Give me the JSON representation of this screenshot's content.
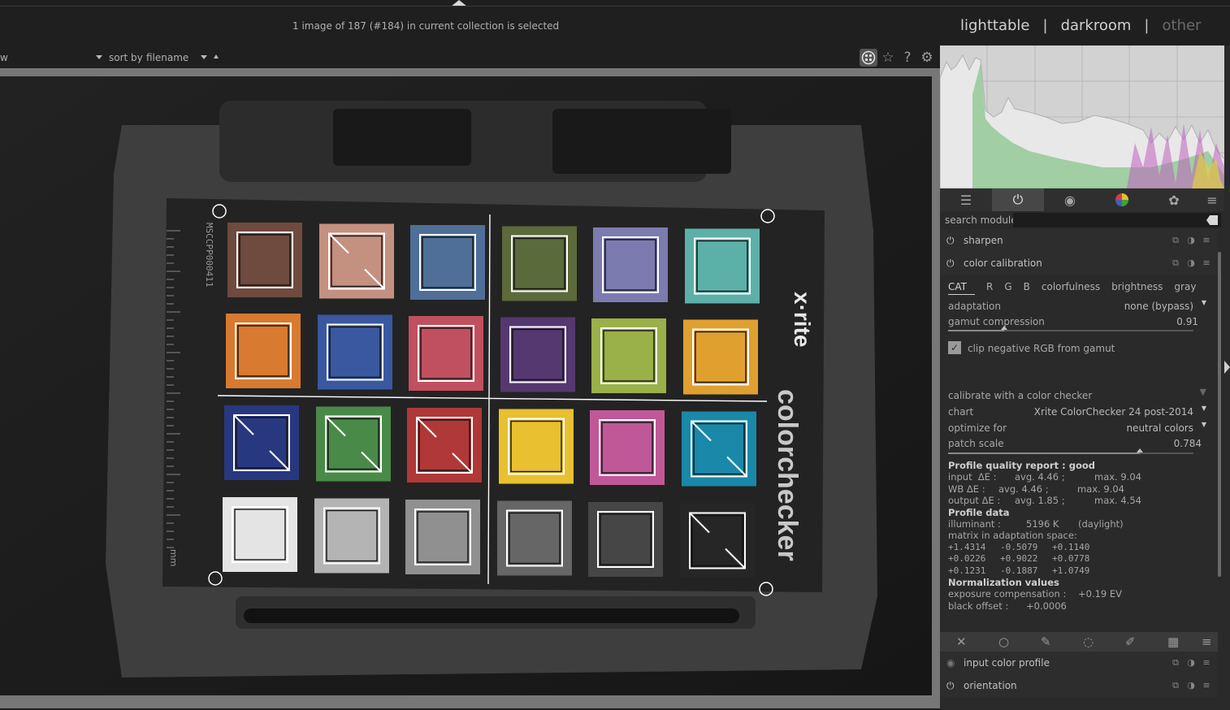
{
  "header": {
    "status_text": "1 image of 187 (#184) in current collection is selected",
    "views": [
      "lighttable",
      "darkroom",
      "other"
    ],
    "separator": "|"
  },
  "filterbar": {
    "left_fragment": "w",
    "sort_label": "sort by",
    "sort_value": "filename"
  },
  "right_panel": {
    "search_label": "search module",
    "search_placeholder": "",
    "modules": {
      "sharpen": "sharpen",
      "color_calibration": "color calibration",
      "input_color_profile": "input color profile",
      "orientation": "orientation"
    },
    "cc": {
      "tabs": [
        "CAT",
        "R",
        "G",
        "B",
        "colorfulness",
        "brightness",
        "gray"
      ],
      "adaptation_label": "adaptation",
      "adaptation_value": "none (bypass)",
      "gamut_label": "gamut compression",
      "gamut_value": "0.91",
      "gamut_fraction": 0.23,
      "clip_label": "clip negative RGB from gamut",
      "clip_checked": true,
      "checker_section": "calibrate with a color checker",
      "chart_label": "chart",
      "chart_value": "Xrite ColorChecker 24 post-2014",
      "optimize_label": "optimize for",
      "optimize_value": "neutral colors",
      "patch_label": "patch scale",
      "patch_value": "0.784",
      "patch_fraction": 0.78
    },
    "report": {
      "title": "Profile quality report : good",
      "input_label": "input  ΔE :",
      "input_avg": "avg. 4.46 ;",
      "input_max": "max. 9.04",
      "wb_label": "WB ΔE :",
      "wb_avg": "avg. 4.46 ;",
      "wb_max": "max. 9.04",
      "output_label": "output ΔE :",
      "output_avg": "avg. 1.85 ;",
      "output_max": "max. 4.54",
      "profile_title": "Profile data",
      "illuminant_label": "illuminant :",
      "illuminant_value": "5196 K",
      "illuminant_note": "(daylight)",
      "matrix_label": "matrix in adaptation space:",
      "matrix": [
        [
          "+1.4314",
          "-0.5079",
          "+0.1140"
        ],
        [
          "+0.0226",
          "+0.9022",
          "+0.0778"
        ],
        [
          "+0.1231",
          "-0.1887",
          "+1.0749"
        ]
      ],
      "norm_title": "Normalization values",
      "exposure_label": "exposure compensation :",
      "exposure_value": "+0.19 EV",
      "black_label": "black offset :",
      "black_value": "+0.0006"
    }
  },
  "checker": {
    "brand": "x·rite",
    "product": "colorchecker",
    "serial": "MSCCPP000411",
    "unit": "mm",
    "patches": [
      "#6f4a3e",
      "#c49080",
      "#4f6f98",
      "#5a6a3a",
      "#7b7bb0",
      "#5cb0a8",
      "#d87a30",
      "#3a58a0",
      "#c05060",
      "#553870",
      "#9ab048",
      "#e0a030",
      "#283880",
      "#4a8a48",
      "#b03838",
      "#e8c030",
      "#c05898",
      "#1a88a8",
      "#e4e4e4",
      "#b4b4b4",
      "#909090",
      "#666666",
      "#464646",
      "#262626"
    ]
  }
}
